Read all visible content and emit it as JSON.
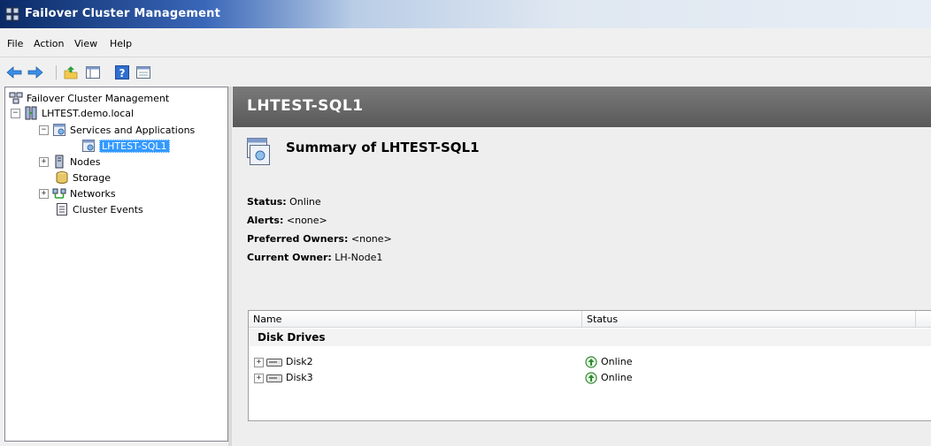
{
  "window": {
    "title": "Failover Cluster Management"
  },
  "menu": {
    "items": [
      "File",
      "Action",
      "View",
      "Help"
    ]
  },
  "toolbar": {
    "buttons": [
      "back-arrow-icon",
      "forward-arrow-icon",
      "up-folder-icon",
      "show-hide-tree-icon",
      "help-icon",
      "properties-icon"
    ]
  },
  "tree": {
    "root": "Failover Cluster Management",
    "cluster": "LHTEST.demo.local",
    "services": "Services and Applications",
    "selected": "LHTEST-SQL1",
    "nodes": "Nodes",
    "storage": "Storage",
    "networks": "Networks",
    "events": "Cluster Events"
  },
  "content": {
    "header": "LHTEST-SQL1",
    "summary_title": "Summary of LHTEST-SQL1",
    "props": {
      "status_label": "Status:",
      "status_value": "Online",
      "alerts_label": "Alerts:",
      "alerts_value": "<none>",
      "owners_label": "Preferred Owners:",
      "owners_value": "<none>",
      "current_label": "Current Owner:",
      "current_value": "LH-Node1"
    },
    "table": {
      "columns": [
        "Name",
        "Status"
      ],
      "group": "Disk Drives",
      "rows": [
        {
          "name": "Disk2",
          "status": "Online"
        },
        {
          "name": "Disk3",
          "status": "Online"
        }
      ]
    }
  },
  "colors": {
    "selection": "#3399ff",
    "header_bg": "#666666",
    "status_online": "#2e8b2e"
  }
}
